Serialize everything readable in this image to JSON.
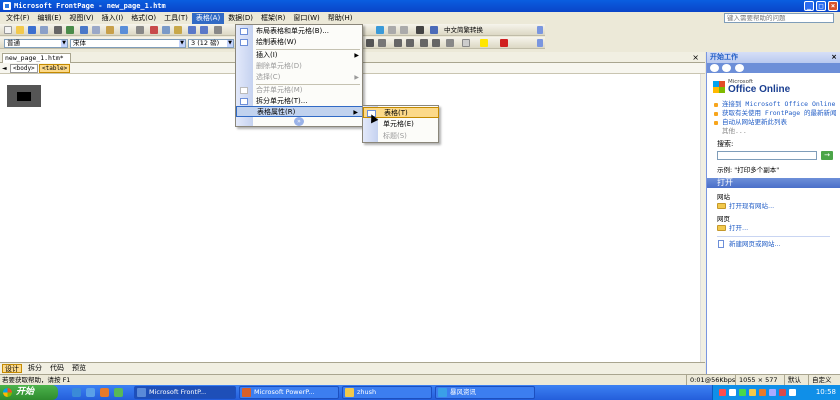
{
  "window": {
    "title": "Microsoft FrontPage - new_page_1.htm"
  },
  "menubar": {
    "items": [
      "文件(F)",
      "编辑(E)",
      "视图(V)",
      "插入(I)",
      "格式(O)",
      "工具(T)",
      "表格(A)",
      "数据(D)",
      "框架(R)",
      "窗口(W)",
      "帮助(H)"
    ],
    "active": "表格(A)",
    "help_placeholder": "键入需要帮助的问题"
  },
  "toolbar": {
    "style_value": "普通",
    "font_value": "宋体",
    "size_value": "3 (12 磅)",
    "convert_label": "中文简繁转换"
  },
  "document": {
    "tab_label": "new_page_1.htm*",
    "close_symbol": "×",
    "tags": [
      "<body>",
      "<table>"
    ],
    "tag_arrow": "◄"
  },
  "table_menu": {
    "items": [
      {
        "label": "布局表格和单元格(B)...",
        "disabled": false
      },
      {
        "label": "绘制表格(W)",
        "disabled": false
      },
      {
        "label": "插入(I)",
        "disabled": false,
        "submenu": true
      },
      {
        "label": "删除单元格(D)",
        "disabled": true
      },
      {
        "label": "选择(C)",
        "disabled": true,
        "submenu": true
      },
      {
        "label": "合并单元格(M)",
        "disabled": true
      },
      {
        "label": "拆分单元格(T)...",
        "disabled": false
      },
      {
        "label": "表格属性(R)",
        "disabled": false,
        "submenu": true,
        "hover": true
      }
    ],
    "more_symbol": "»"
  },
  "properties_submenu": {
    "items": [
      {
        "label": "表格(T)",
        "disabled": false,
        "hover": true
      },
      {
        "label": "单元格(E)",
        "disabled": false
      },
      {
        "label": "标题(S)",
        "disabled": true
      }
    ]
  },
  "view_tabs": [
    "设计",
    "拆分",
    "代码",
    "预览"
  ],
  "status": {
    "left": "若要获取帮助，请按 F1",
    "speed": "0:01@56Kbps",
    "dimensions": "1055 × 577",
    "mode": "默认",
    "custom": "自定义"
  },
  "taskpane": {
    "title": "开始工作",
    "close_symbol": "×",
    "brand": "Microsoft",
    "office": "Office Online",
    "links": [
      "连接到 Microsoft Office Online",
      "获取有关使用 FrontPage 的最新新闻",
      "自动从网站更新此列表"
    ],
    "more": "其他...",
    "search_label": "搜索:",
    "go_symbol": "→",
    "example": "示例: \"打印多个副本\"",
    "open_title": "打开",
    "website_label": "网站",
    "open_website": "打开现有网站...",
    "page_label": "网页",
    "open_page": "打开...",
    "new_site": "新建网页或网站..."
  },
  "taskbar": {
    "start": "开始",
    "buttons": [
      "Microsoft FrontP...",
      "Microsoft PowerP...",
      "zhush",
      "暴风资讯"
    ],
    "clock": "10:58"
  },
  "colors": {
    "title_blue": "#0a5ee0",
    "menu_highlight": "#316ac5",
    "submenu_highlight": "#fcd989",
    "taskbar_blue": "#245edb",
    "start_green": "#2e8b2e"
  }
}
